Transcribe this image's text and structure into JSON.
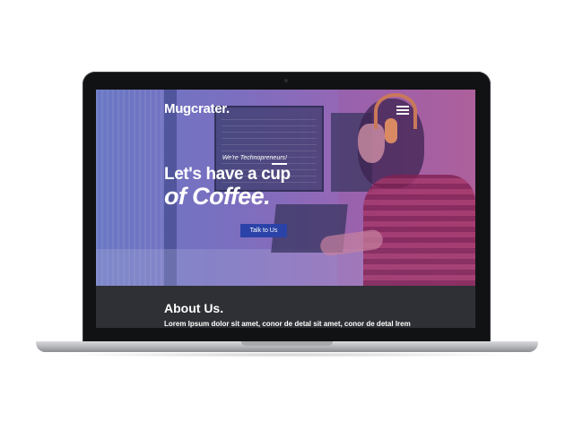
{
  "site": {
    "logo": "Mugcrater.",
    "menu_icon": "hamburger-menu-icon",
    "hero": {
      "tagline": "We're Technopreneurs!",
      "headline_line1": "Let's have a cup",
      "headline_line2": "of Coffee.",
      "cta_label": "Talk to Us"
    },
    "about": {
      "title": "About Us.",
      "text": "Lorem Ipsum dolor sit amet, conor de detal sit amet, conor de detal Irem"
    }
  },
  "colors": {
    "hero_gradient_start": "#6a78c4",
    "hero_gradient_end": "#b1649f",
    "cta_background": "#2b43a8",
    "about_background": "#2f3035",
    "bezel": "#111214"
  }
}
